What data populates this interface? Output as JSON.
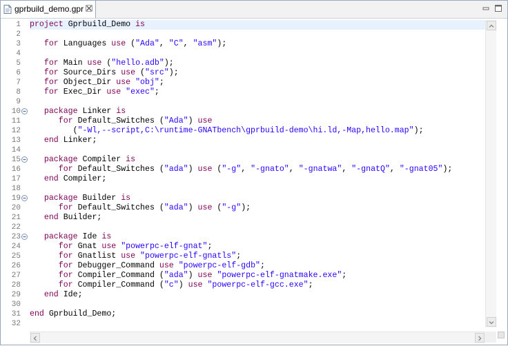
{
  "tab": {
    "label": "gprbuild_demo.gpr"
  },
  "lines": [
    {
      "n": "1",
      "fold": false,
      "tokens": [
        {
          "t": "project",
          "c": "kw"
        },
        {
          "t": " Gprbuild_Demo ",
          "c": ""
        },
        {
          "t": "is",
          "c": "kw"
        }
      ]
    },
    {
      "n": "2",
      "fold": false,
      "tokens": []
    },
    {
      "n": "3",
      "fold": false,
      "tokens": [
        {
          "t": "   ",
          "c": ""
        },
        {
          "t": "for",
          "c": "kw"
        },
        {
          "t": " Languages ",
          "c": ""
        },
        {
          "t": "use",
          "c": "kw"
        },
        {
          "t": " (",
          "c": ""
        },
        {
          "t": "\"Ada\"",
          "c": "str"
        },
        {
          "t": ", ",
          "c": ""
        },
        {
          "t": "\"C\"",
          "c": "str"
        },
        {
          "t": ", ",
          "c": ""
        },
        {
          "t": "\"asm\"",
          "c": "str"
        },
        {
          "t": ");",
          "c": ""
        }
      ]
    },
    {
      "n": "4",
      "fold": false,
      "tokens": []
    },
    {
      "n": "5",
      "fold": false,
      "tokens": [
        {
          "t": "   ",
          "c": ""
        },
        {
          "t": "for",
          "c": "kw"
        },
        {
          "t": " Main ",
          "c": ""
        },
        {
          "t": "use",
          "c": "kw"
        },
        {
          "t": " (",
          "c": ""
        },
        {
          "t": "\"hello.adb\"",
          "c": "str"
        },
        {
          "t": ");",
          "c": ""
        }
      ]
    },
    {
      "n": "6",
      "fold": false,
      "tokens": [
        {
          "t": "   ",
          "c": ""
        },
        {
          "t": "for",
          "c": "kw"
        },
        {
          "t": " Source_Dirs ",
          "c": ""
        },
        {
          "t": "use",
          "c": "kw"
        },
        {
          "t": " (",
          "c": ""
        },
        {
          "t": "\"src\"",
          "c": "str"
        },
        {
          "t": ");",
          "c": ""
        }
      ]
    },
    {
      "n": "7",
      "fold": false,
      "tokens": [
        {
          "t": "   ",
          "c": ""
        },
        {
          "t": "for",
          "c": "kw"
        },
        {
          "t": " Object_Dir ",
          "c": ""
        },
        {
          "t": "use",
          "c": "kw"
        },
        {
          "t": " ",
          "c": ""
        },
        {
          "t": "\"obj\"",
          "c": "str"
        },
        {
          "t": ";",
          "c": ""
        }
      ]
    },
    {
      "n": "8",
      "fold": false,
      "tokens": [
        {
          "t": "   ",
          "c": ""
        },
        {
          "t": "for",
          "c": "kw"
        },
        {
          "t": " Exec_Dir ",
          "c": ""
        },
        {
          "t": "use",
          "c": "kw"
        },
        {
          "t": " ",
          "c": ""
        },
        {
          "t": "\"exec\"",
          "c": "str"
        },
        {
          "t": ";",
          "c": ""
        }
      ]
    },
    {
      "n": "9",
      "fold": false,
      "tokens": []
    },
    {
      "n": "10",
      "fold": true,
      "tokens": [
        {
          "t": "   ",
          "c": ""
        },
        {
          "t": "package",
          "c": "kw"
        },
        {
          "t": " Linker ",
          "c": ""
        },
        {
          "t": "is",
          "c": "kw"
        }
      ]
    },
    {
      "n": "11",
      "fold": false,
      "tokens": [
        {
          "t": "      ",
          "c": ""
        },
        {
          "t": "for",
          "c": "kw"
        },
        {
          "t": " Default_Switches (",
          "c": ""
        },
        {
          "t": "\"Ada\"",
          "c": "str"
        },
        {
          "t": ") ",
          "c": ""
        },
        {
          "t": "use",
          "c": "kw"
        }
      ]
    },
    {
      "n": "12",
      "fold": false,
      "tokens": [
        {
          "t": "         (",
          "c": ""
        },
        {
          "t": "\"-Wl,--script,C:\\runtime-GNATbench\\gprbuild-demo\\hi.ld,-Map,hello.map\"",
          "c": "str"
        },
        {
          "t": ");",
          "c": ""
        }
      ]
    },
    {
      "n": "13",
      "fold": false,
      "tokens": [
        {
          "t": "   ",
          "c": ""
        },
        {
          "t": "end",
          "c": "kw"
        },
        {
          "t": " Linker;",
          "c": ""
        }
      ]
    },
    {
      "n": "14",
      "fold": false,
      "tokens": []
    },
    {
      "n": "15",
      "fold": true,
      "tokens": [
        {
          "t": "   ",
          "c": ""
        },
        {
          "t": "package",
          "c": "kw"
        },
        {
          "t": " Compiler ",
          "c": ""
        },
        {
          "t": "is",
          "c": "kw"
        }
      ]
    },
    {
      "n": "16",
      "fold": false,
      "tokens": [
        {
          "t": "      ",
          "c": ""
        },
        {
          "t": "for",
          "c": "kw"
        },
        {
          "t": " Default_Switches (",
          "c": ""
        },
        {
          "t": "\"ada\"",
          "c": "str"
        },
        {
          "t": ") ",
          "c": ""
        },
        {
          "t": "use",
          "c": "kw"
        },
        {
          "t": " (",
          "c": ""
        },
        {
          "t": "\"-g\"",
          "c": "str"
        },
        {
          "t": ", ",
          "c": ""
        },
        {
          "t": "\"-gnato\"",
          "c": "str"
        },
        {
          "t": ", ",
          "c": ""
        },
        {
          "t": "\"-gnatwa\"",
          "c": "str"
        },
        {
          "t": ", ",
          "c": ""
        },
        {
          "t": "\"-gnatQ\"",
          "c": "str"
        },
        {
          "t": ", ",
          "c": ""
        },
        {
          "t": "\"-gnat05\"",
          "c": "str"
        },
        {
          "t": ");",
          "c": ""
        }
      ]
    },
    {
      "n": "17",
      "fold": false,
      "tokens": [
        {
          "t": "   ",
          "c": ""
        },
        {
          "t": "end",
          "c": "kw"
        },
        {
          "t": " Compiler;",
          "c": ""
        }
      ]
    },
    {
      "n": "18",
      "fold": false,
      "tokens": []
    },
    {
      "n": "19",
      "fold": true,
      "tokens": [
        {
          "t": "   ",
          "c": ""
        },
        {
          "t": "package",
          "c": "kw"
        },
        {
          "t": " Builder ",
          "c": ""
        },
        {
          "t": "is",
          "c": "kw"
        }
      ]
    },
    {
      "n": "20",
      "fold": false,
      "tokens": [
        {
          "t": "      ",
          "c": ""
        },
        {
          "t": "for",
          "c": "kw"
        },
        {
          "t": " Default_Switches (",
          "c": ""
        },
        {
          "t": "\"ada\"",
          "c": "str"
        },
        {
          "t": ") ",
          "c": ""
        },
        {
          "t": "use",
          "c": "kw"
        },
        {
          "t": " (",
          "c": ""
        },
        {
          "t": "\"-g\"",
          "c": "str"
        },
        {
          "t": ");",
          "c": ""
        }
      ]
    },
    {
      "n": "21",
      "fold": false,
      "tokens": [
        {
          "t": "   ",
          "c": ""
        },
        {
          "t": "end",
          "c": "kw"
        },
        {
          "t": " Builder;",
          "c": ""
        }
      ]
    },
    {
      "n": "22",
      "fold": false,
      "tokens": []
    },
    {
      "n": "23",
      "fold": true,
      "tokens": [
        {
          "t": "   ",
          "c": ""
        },
        {
          "t": "package",
          "c": "kw"
        },
        {
          "t": " Ide ",
          "c": ""
        },
        {
          "t": "is",
          "c": "kw"
        }
      ]
    },
    {
      "n": "24",
      "fold": false,
      "tokens": [
        {
          "t": "      ",
          "c": ""
        },
        {
          "t": "for",
          "c": "kw"
        },
        {
          "t": " Gnat ",
          "c": ""
        },
        {
          "t": "use",
          "c": "kw"
        },
        {
          "t": " ",
          "c": ""
        },
        {
          "t": "\"powerpc-elf-gnat\"",
          "c": "str"
        },
        {
          "t": ";",
          "c": ""
        }
      ]
    },
    {
      "n": "25",
      "fold": false,
      "tokens": [
        {
          "t": "      ",
          "c": ""
        },
        {
          "t": "for",
          "c": "kw"
        },
        {
          "t": " Gnatlist ",
          "c": ""
        },
        {
          "t": "use",
          "c": "kw"
        },
        {
          "t": " ",
          "c": ""
        },
        {
          "t": "\"powerpc-elf-gnatls\"",
          "c": "str"
        },
        {
          "t": ";",
          "c": ""
        }
      ]
    },
    {
      "n": "26",
      "fold": false,
      "tokens": [
        {
          "t": "      ",
          "c": ""
        },
        {
          "t": "for",
          "c": "kw"
        },
        {
          "t": " Debugger_Command ",
          "c": ""
        },
        {
          "t": "use",
          "c": "kw"
        },
        {
          "t": " ",
          "c": ""
        },
        {
          "t": "\"powerpc-elf-gdb\"",
          "c": "str"
        },
        {
          "t": ";",
          "c": ""
        }
      ]
    },
    {
      "n": "27",
      "fold": false,
      "tokens": [
        {
          "t": "      ",
          "c": ""
        },
        {
          "t": "for",
          "c": "kw"
        },
        {
          "t": " Compiler_Command (",
          "c": ""
        },
        {
          "t": "\"ada\"",
          "c": "str"
        },
        {
          "t": ") ",
          "c": ""
        },
        {
          "t": "use",
          "c": "kw"
        },
        {
          "t": " ",
          "c": ""
        },
        {
          "t": "\"powerpc-elf-gnatmake.exe\"",
          "c": "str"
        },
        {
          "t": ";",
          "c": ""
        }
      ]
    },
    {
      "n": "28",
      "fold": false,
      "tokens": [
        {
          "t": "      ",
          "c": ""
        },
        {
          "t": "for",
          "c": "kw"
        },
        {
          "t": " Compiler_Command (",
          "c": ""
        },
        {
          "t": "\"c\"",
          "c": "str"
        },
        {
          "t": ") ",
          "c": ""
        },
        {
          "t": "use",
          "c": "kw"
        },
        {
          "t": " ",
          "c": ""
        },
        {
          "t": "\"powerpc-elf-gcc.exe\"",
          "c": "str"
        },
        {
          "t": ";",
          "c": ""
        }
      ]
    },
    {
      "n": "29",
      "fold": false,
      "tokens": [
        {
          "t": "   ",
          "c": ""
        },
        {
          "t": "end",
          "c": "kw"
        },
        {
          "t": " Ide;",
          "c": ""
        }
      ]
    },
    {
      "n": "30",
      "fold": false,
      "tokens": []
    },
    {
      "n": "31",
      "fold": false,
      "tokens": [
        {
          "t": "end",
          "c": "kw"
        },
        {
          "t": " Gprbuild_Demo;",
          "c": ""
        }
      ]
    },
    {
      "n": "32",
      "fold": false,
      "tokens": []
    }
  ]
}
